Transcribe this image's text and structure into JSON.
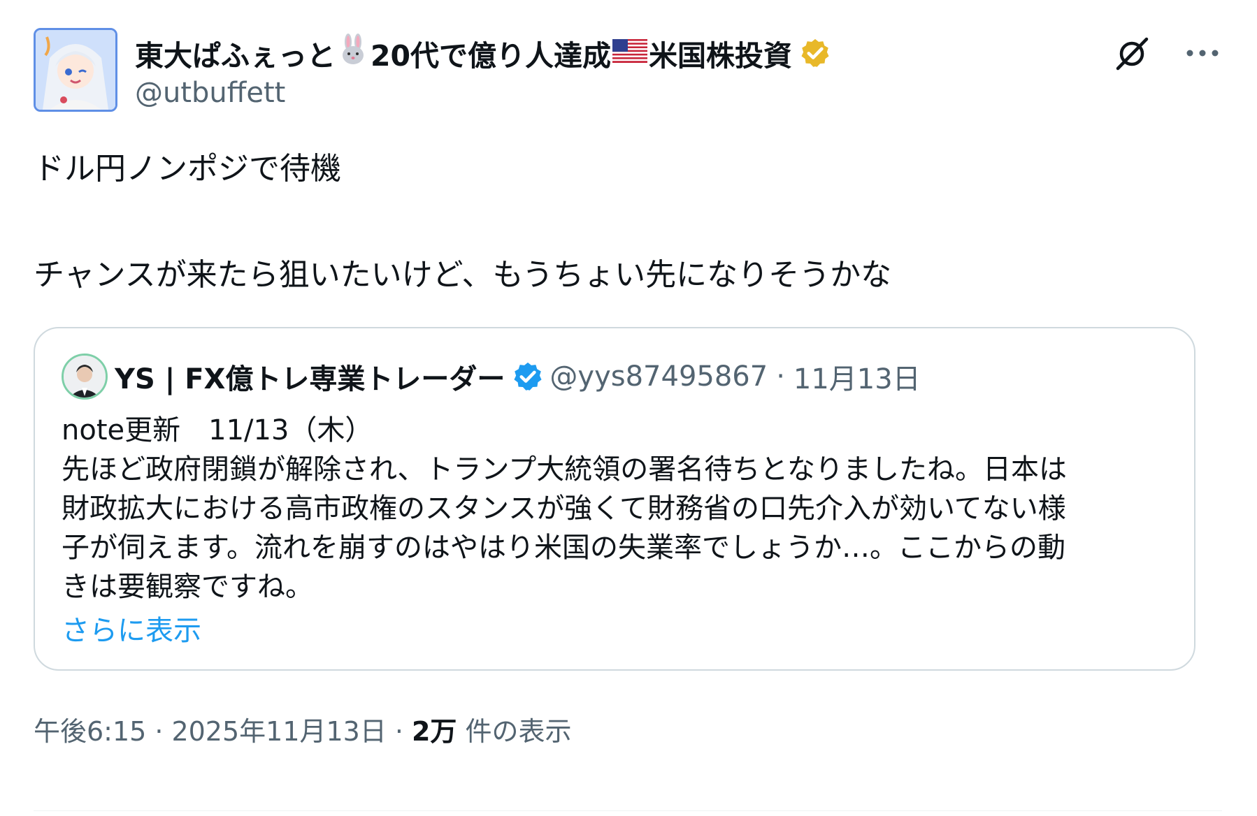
{
  "author": {
    "name_part1": "東大ぱふぇっと",
    "name_part2": "20代で億り人達成",
    "name_part3": "米国株投資",
    "handle": "@utbuffett",
    "verified_color": "#e8b829"
  },
  "icons": {
    "rabbit": "rabbit-emoji",
    "flag": "us-flag-emoji",
    "grok": "grok-icon",
    "more": "more-icon"
  },
  "post": {
    "line1": "ドル円ノンポジで待機",
    "line2": "チャンスが来たら狙いたいけど、もうちょい先になりそうかな"
  },
  "quote": {
    "name": "YS | FX億トレ専業トレーダー",
    "handle": "@yys87495867",
    "separator": "·",
    "date": "11月13日",
    "verified_color": "#1d9bf0",
    "body_lines": [
      "note更新　11/13（木）",
      "先ほど政府閉鎖が解除され、トランプ大統領の署名待ちとなりましたね。日本は",
      "財政拡大における高市政権のスタンスが強くて財務省の口先介入が効いてない様",
      "子が伺えます。流れを崩すのはやはり米国の失業率でしょうか…。ここからの動",
      "きは要観察ですね。"
    ],
    "show_more": "さらに表示"
  },
  "meta": {
    "time": "午後6:15",
    "sep": "·",
    "date": "2025年11月13日",
    "views_count": "2万",
    "views_label": "件の表示"
  }
}
